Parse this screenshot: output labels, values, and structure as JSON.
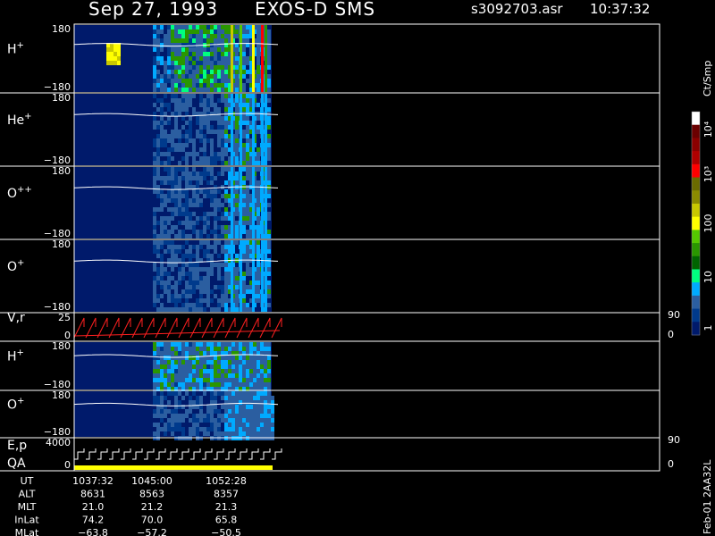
{
  "header": {
    "date": "Sep 27, 1993",
    "instrument": "EXOS-D SMS",
    "file": "s3092703.asr",
    "time": "10:37:32"
  },
  "chart_data": {
    "type": "heatmap",
    "colorbar": {
      "unit": "Ct/Smp",
      "labels": [
        "10⁴",
        "10³",
        "100",
        "10",
        "1"
      ],
      "colors": [
        "#ffffff",
        "#6b0000",
        "#8b0000",
        "#b00000",
        "#ff0000",
        "#6b6b00",
        "#8b8b00",
        "#c8c800",
        "#ffff00",
        "#55c800",
        "#2a9600",
        "#006400",
        "#00ff7f",
        "#00aaff",
        "#2b5ea0",
        "#003a8c",
        "#001a6b"
      ]
    },
    "panels": [
      {
        "id": "hplus1",
        "label": "H",
        "sup": "+",
        "ytop": "180",
        "ybot": "−180",
        "right_top": "",
        "right_bot": ""
      },
      {
        "id": "heplus",
        "label": "He",
        "sup": "+",
        "ytop": "180",
        "ybot": "−180",
        "right_top": "",
        "right_bot": ""
      },
      {
        "id": "oplusplus",
        "label": "O",
        "sup": "++",
        "ytop": "180",
        "ybot": "−180",
        "right_top": "",
        "right_bot": ""
      },
      {
        "id": "oplus1",
        "label": "O",
        "sup": "+",
        "ytop": "180",
        "ybot": "−180",
        "right_top": "",
        "right_bot": ""
      },
      {
        "id": "vr",
        "label": "V,r",
        "sup": "",
        "ytop": "25",
        "ybot": "0",
        "right_top": "90",
        "right_bot": "0"
      },
      {
        "id": "hplus2",
        "label": "H",
        "sup": "+",
        "ytop": "180",
        "ybot": "−180",
        "right_top": "",
        "right_bot": ""
      },
      {
        "id": "oplus2",
        "label": "O",
        "sup": "+",
        "ytop": "180",
        "ybot": "−180",
        "right_top": "",
        "right_bot": ""
      },
      {
        "id": "ep",
        "label": "E,p",
        "sup": "",
        "ytop": "4000",
        "ybot": "0",
        "right_top": "90",
        "right_bot": "0",
        "extra_label": "QA"
      }
    ],
    "ephemeris": {
      "rows": [
        {
          "name": "UT",
          "values": [
            "1037:32",
            "1045:00",
            "1052:28"
          ]
        },
        {
          "name": "ALT",
          "values": [
            "8631",
            "8563",
            "8357"
          ]
        },
        {
          "name": "MLT",
          "values": [
            "21.0",
            "21.2",
            "21.3"
          ]
        },
        {
          "name": "InLat",
          "values": [
            "74.2",
            "70.0",
            "65.8"
          ]
        },
        {
          "name": "MLat",
          "values": [
            "−63.8",
            "−57.2",
            "−50.5"
          ]
        }
      ]
    },
    "footer_id": "Feb-01 2AA32L"
  }
}
